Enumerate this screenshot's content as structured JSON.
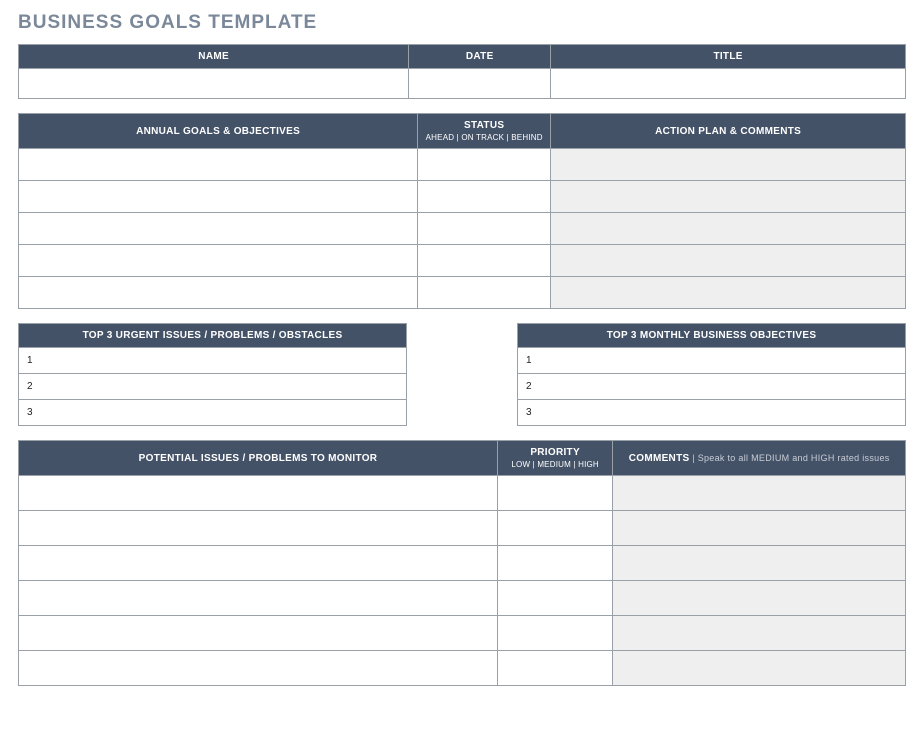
{
  "title": "BUSINESS GOALS TEMPLATE",
  "info": {
    "headers": {
      "name": "NAME",
      "date": "DATE",
      "title": "TITLE"
    },
    "row": {
      "name": "",
      "date": "",
      "title": ""
    }
  },
  "goals": {
    "headers": {
      "col1": "ANNUAL GOALS & OBJECTIVES",
      "col2_top": "STATUS",
      "col2_sub": "AHEAD | ON TRACK | BEHIND",
      "col3": "ACTION PLAN & COMMENTS"
    },
    "rows": [
      {
        "goal": "",
        "status": "",
        "plan": ""
      },
      {
        "goal": "",
        "status": "",
        "plan": ""
      },
      {
        "goal": "",
        "status": "",
        "plan": ""
      },
      {
        "goal": "",
        "status": "",
        "plan": ""
      },
      {
        "goal": "",
        "status": "",
        "plan": ""
      }
    ]
  },
  "issues": {
    "header": "TOP 3 URGENT ISSUES / PROBLEMS / OBSTACLES",
    "rows": [
      {
        "num": "1",
        "text": ""
      },
      {
        "num": "2",
        "text": ""
      },
      {
        "num": "3",
        "text": ""
      }
    ]
  },
  "objectives": {
    "header": "TOP 3 MONTHLY BUSINESS OBJECTIVES",
    "rows": [
      {
        "num": "1",
        "text": ""
      },
      {
        "num": "2",
        "text": ""
      },
      {
        "num": "3",
        "text": ""
      }
    ]
  },
  "monitor": {
    "headers": {
      "col1": "POTENTIAL ISSUES / PROBLEMS TO MONITOR",
      "col2_top": "PRIORITY",
      "col2_sub": "LOW | MEDIUM | HIGH",
      "col3_main": "COMMENTS",
      "col3_sub": " | Speak to all MEDIUM and HIGH rated issues"
    },
    "rows": [
      {
        "issue": "",
        "priority": "",
        "comment": ""
      },
      {
        "issue": "",
        "priority": "",
        "comment": ""
      },
      {
        "issue": "",
        "priority": "",
        "comment": ""
      },
      {
        "issue": "",
        "priority": "",
        "comment": ""
      },
      {
        "issue": "",
        "priority": "",
        "comment": ""
      },
      {
        "issue": "",
        "priority": "",
        "comment": ""
      }
    ]
  }
}
